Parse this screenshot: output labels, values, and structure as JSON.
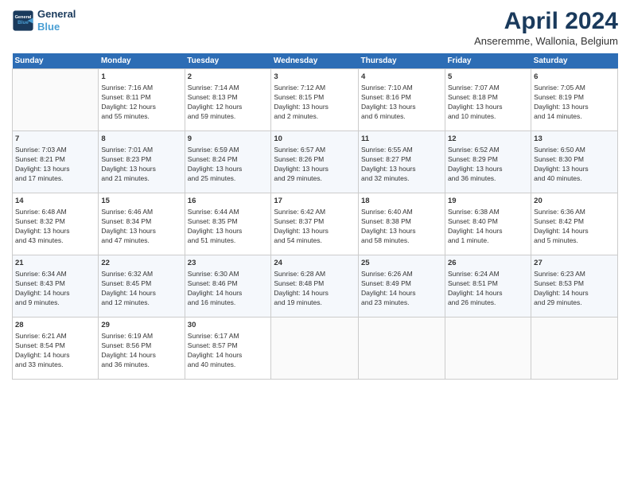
{
  "header": {
    "logo_line1": "General",
    "logo_line2": "Blue",
    "title": "April 2024",
    "subtitle": "Anseremme, Wallonia, Belgium"
  },
  "weekdays": [
    "Sunday",
    "Monday",
    "Tuesday",
    "Wednesday",
    "Thursday",
    "Friday",
    "Saturday"
  ],
  "weeks": [
    [
      {
        "day": "",
        "info": ""
      },
      {
        "day": "1",
        "info": "Sunrise: 7:16 AM\nSunset: 8:11 PM\nDaylight: 12 hours\nand 55 minutes."
      },
      {
        "day": "2",
        "info": "Sunrise: 7:14 AM\nSunset: 8:13 PM\nDaylight: 12 hours\nand 59 minutes."
      },
      {
        "day": "3",
        "info": "Sunrise: 7:12 AM\nSunset: 8:15 PM\nDaylight: 13 hours\nand 2 minutes."
      },
      {
        "day": "4",
        "info": "Sunrise: 7:10 AM\nSunset: 8:16 PM\nDaylight: 13 hours\nand 6 minutes."
      },
      {
        "day": "5",
        "info": "Sunrise: 7:07 AM\nSunset: 8:18 PM\nDaylight: 13 hours\nand 10 minutes."
      },
      {
        "day": "6",
        "info": "Sunrise: 7:05 AM\nSunset: 8:19 PM\nDaylight: 13 hours\nand 14 minutes."
      }
    ],
    [
      {
        "day": "7",
        "info": "Sunrise: 7:03 AM\nSunset: 8:21 PM\nDaylight: 13 hours\nand 17 minutes."
      },
      {
        "day": "8",
        "info": "Sunrise: 7:01 AM\nSunset: 8:23 PM\nDaylight: 13 hours\nand 21 minutes."
      },
      {
        "day": "9",
        "info": "Sunrise: 6:59 AM\nSunset: 8:24 PM\nDaylight: 13 hours\nand 25 minutes."
      },
      {
        "day": "10",
        "info": "Sunrise: 6:57 AM\nSunset: 8:26 PM\nDaylight: 13 hours\nand 29 minutes."
      },
      {
        "day": "11",
        "info": "Sunrise: 6:55 AM\nSunset: 8:27 PM\nDaylight: 13 hours\nand 32 minutes."
      },
      {
        "day": "12",
        "info": "Sunrise: 6:52 AM\nSunset: 8:29 PM\nDaylight: 13 hours\nand 36 minutes."
      },
      {
        "day": "13",
        "info": "Sunrise: 6:50 AM\nSunset: 8:30 PM\nDaylight: 13 hours\nand 40 minutes."
      }
    ],
    [
      {
        "day": "14",
        "info": "Sunrise: 6:48 AM\nSunset: 8:32 PM\nDaylight: 13 hours\nand 43 minutes."
      },
      {
        "day": "15",
        "info": "Sunrise: 6:46 AM\nSunset: 8:34 PM\nDaylight: 13 hours\nand 47 minutes."
      },
      {
        "day": "16",
        "info": "Sunrise: 6:44 AM\nSunset: 8:35 PM\nDaylight: 13 hours\nand 51 minutes."
      },
      {
        "day": "17",
        "info": "Sunrise: 6:42 AM\nSunset: 8:37 PM\nDaylight: 13 hours\nand 54 minutes."
      },
      {
        "day": "18",
        "info": "Sunrise: 6:40 AM\nSunset: 8:38 PM\nDaylight: 13 hours\nand 58 minutes."
      },
      {
        "day": "19",
        "info": "Sunrise: 6:38 AM\nSunset: 8:40 PM\nDaylight: 14 hours\nand 1 minute."
      },
      {
        "day": "20",
        "info": "Sunrise: 6:36 AM\nSunset: 8:42 PM\nDaylight: 14 hours\nand 5 minutes."
      }
    ],
    [
      {
        "day": "21",
        "info": "Sunrise: 6:34 AM\nSunset: 8:43 PM\nDaylight: 14 hours\nand 9 minutes."
      },
      {
        "day": "22",
        "info": "Sunrise: 6:32 AM\nSunset: 8:45 PM\nDaylight: 14 hours\nand 12 minutes."
      },
      {
        "day": "23",
        "info": "Sunrise: 6:30 AM\nSunset: 8:46 PM\nDaylight: 14 hours\nand 16 minutes."
      },
      {
        "day": "24",
        "info": "Sunrise: 6:28 AM\nSunset: 8:48 PM\nDaylight: 14 hours\nand 19 minutes."
      },
      {
        "day": "25",
        "info": "Sunrise: 6:26 AM\nSunset: 8:49 PM\nDaylight: 14 hours\nand 23 minutes."
      },
      {
        "day": "26",
        "info": "Sunrise: 6:24 AM\nSunset: 8:51 PM\nDaylight: 14 hours\nand 26 minutes."
      },
      {
        "day": "27",
        "info": "Sunrise: 6:23 AM\nSunset: 8:53 PM\nDaylight: 14 hours\nand 29 minutes."
      }
    ],
    [
      {
        "day": "28",
        "info": "Sunrise: 6:21 AM\nSunset: 8:54 PM\nDaylight: 14 hours\nand 33 minutes."
      },
      {
        "day": "29",
        "info": "Sunrise: 6:19 AM\nSunset: 8:56 PM\nDaylight: 14 hours\nand 36 minutes."
      },
      {
        "day": "30",
        "info": "Sunrise: 6:17 AM\nSunset: 8:57 PM\nDaylight: 14 hours\nand 40 minutes."
      },
      {
        "day": "",
        "info": ""
      },
      {
        "day": "",
        "info": ""
      },
      {
        "day": "",
        "info": ""
      },
      {
        "day": "",
        "info": ""
      }
    ]
  ]
}
